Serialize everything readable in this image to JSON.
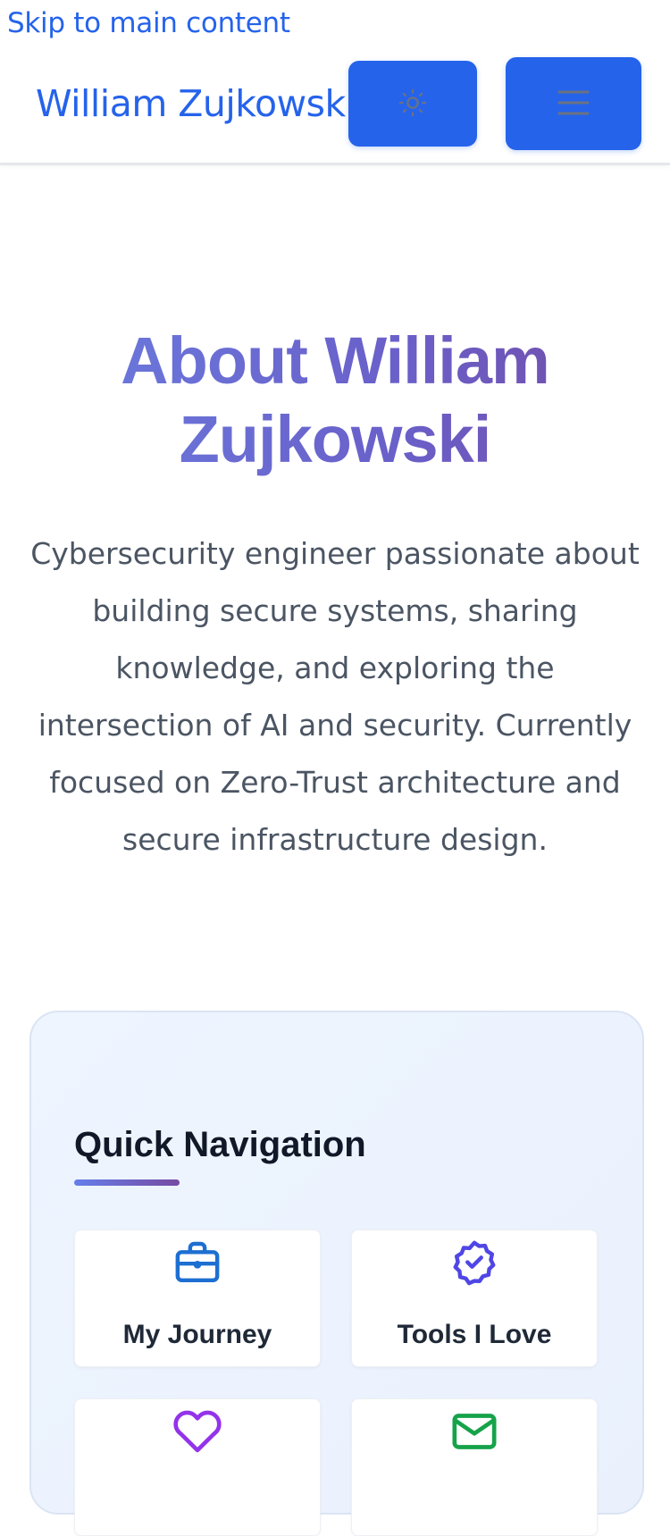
{
  "skip_link": "Skip to main content",
  "header": {
    "brand": "William Zujkowski",
    "theme_toggle_icon": "sun-icon",
    "menu_icon": "hamburger-menu-icon"
  },
  "hero": {
    "title": "About William Zujkowski",
    "description": "Cybersecurity engineer passionate about building secure systems, sharing knowledge, and exploring the intersection of AI and security. Currently focused on Zero-Trust architecture and secure infrastructure design."
  },
  "quick_nav": {
    "title": "Quick Navigation",
    "items": [
      {
        "label": "My Journey",
        "icon": "briefcase-icon",
        "color": "#1d6fd1"
      },
      {
        "label": "Tools I Love",
        "icon": "badge-check-icon",
        "color": "#4f46e5"
      },
      {
        "label": "",
        "icon": "heart-icon",
        "color": "#9333ea"
      },
      {
        "label": "",
        "icon": "envelope-icon",
        "color": "#16a34a"
      }
    ]
  },
  "colors": {
    "accent": "#2563eb",
    "title_gradient_start": "#667eea",
    "title_gradient_end": "#764ba2",
    "text_body": "#4b5563",
    "text_dark": "#111827"
  }
}
